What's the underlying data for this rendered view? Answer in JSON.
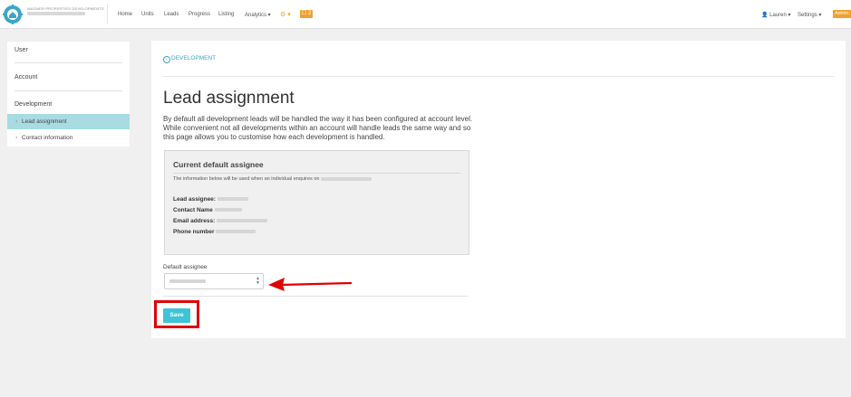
{
  "header": {
    "brand_line": "WAGNER PROPERTIES DEVELOPMENTS",
    "nav": [
      {
        "label": "Home"
      },
      {
        "label": "Units"
      },
      {
        "label": "Leads"
      },
      {
        "label": "Progress"
      },
      {
        "label": "Listing"
      },
      {
        "label": "Analytics ▾"
      }
    ],
    "gear_dropdown": "⚙ ▾",
    "notification_badge": "☐ 2",
    "user_menu": "👤 Lauren ▾",
    "settings_menu": "Settings ▾",
    "admin_label": "Admin"
  },
  "sidebar": {
    "sections": [
      "User",
      "Account",
      "Development"
    ],
    "sub_items": [
      {
        "label": "Lead assignment",
        "active": true
      },
      {
        "label": "Contact information",
        "active": false
      }
    ]
  },
  "main": {
    "back_link": "DEVELOPMENT",
    "title": "Lead assignment",
    "description": "By default all development leads will be handled the way it has been configured at account level. While convenient not all developments within an account will handle leads the same way and so this page allows you to customise how each development is handled.",
    "panel": {
      "title": "Current default assignee",
      "info": "The information below will be used when an individual enquires on",
      "fields": [
        {
          "label": "Lead assignee:"
        },
        {
          "label": "Contact Name"
        },
        {
          "label": "Email address:"
        },
        {
          "label": "Phone number"
        }
      ]
    },
    "assignee_label": "Default assignee",
    "save_label": "Save"
  },
  "colors": {
    "accent": "#3fc3d6",
    "orange": "#f0a030",
    "highlight": "#e00000",
    "sidebar_active": "#a9dbe3"
  }
}
